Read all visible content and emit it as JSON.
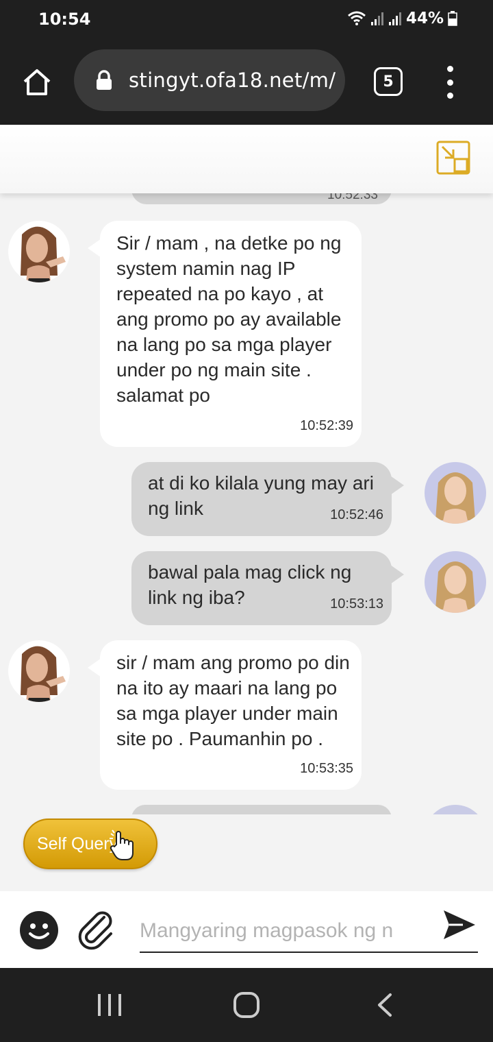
{
  "status_bar": {
    "time": "10:54",
    "battery": "44%"
  },
  "browser": {
    "url": "stingyt.ofa18.net/m/",
    "tab_count": "5"
  },
  "chat": {
    "partial_top_time": "10:52:33",
    "messages": [
      {
        "sender": "agent",
        "text": "Sir / mam , na detke po ng system namin nag IP repeated na po kayo , at ang promo po ay available na lang po sa mga player under po ng main site . salamat po",
        "time": "10:52:39"
      },
      {
        "sender": "user",
        "text": "at di ko kilala yung may ari ng link",
        "time": "10:52:46"
      },
      {
        "sender": "user",
        "text": "bawal pala mag click ng link ng iba?",
        "time": "10:53:13"
      },
      {
        "sender": "agent",
        "text": "sir / mam ang promo po din na ito ay maari na lang po sa mga player under main site po . Paumanhin po .",
        "time": "10:53:35"
      }
    ]
  },
  "self_query": {
    "label": "Self Query"
  },
  "input": {
    "placeholder": "Mangyaring magpasok ng n"
  },
  "colors": {
    "agent_bubble": "#ffffff",
    "user_bubble": "#d4d4d4",
    "self_query_gold": "#e0a918",
    "chrome_dark": "#1f1f1f"
  },
  "icons": {
    "home": "home-icon",
    "lock": "lock-icon",
    "minimize": "minimize-window-icon",
    "emoji": "smiley-icon",
    "attach": "paperclip-icon",
    "send": "send-icon",
    "hand": "pointing-hand-icon"
  }
}
